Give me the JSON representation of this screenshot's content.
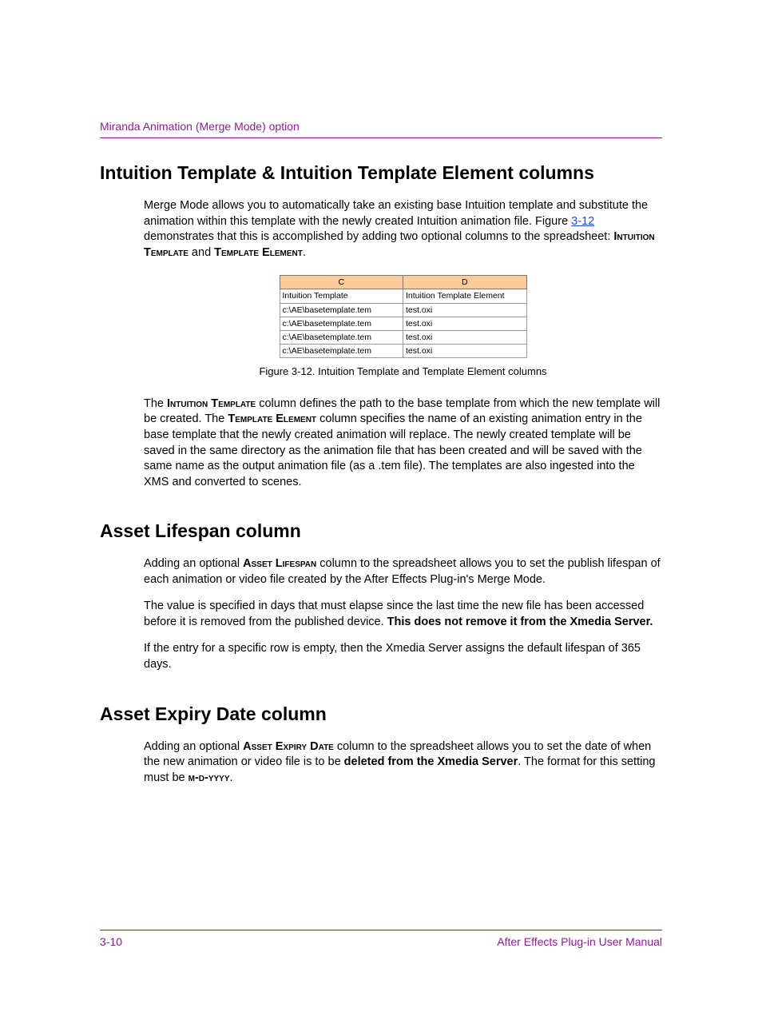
{
  "header": {
    "chapter": "Miranda Animation (Merge Mode) option"
  },
  "section1": {
    "title": "Intuition Template & Intuition Template Element columns",
    "p1a": "Merge Mode allows you to automatically take an existing base Intuition template and substitute the animation within this template with the newly created Intuition animation file. Figure ",
    "p1link": "3-12",
    "p1b": " demonstrates that this is accomplished by adding two optional columns to the spreadsheet: ",
    "p1sc1": "Intuition Template",
    "p1mid": " and ",
    "p1sc2": "Template Element",
    "p1end": ".",
    "caption": "Figure 3-12. Intuition Template and Template Element columns",
    "p2a": "The ",
    "p2sc1": "Intuition Template",
    "p2b": " column defines the path to the base template from which the new template will be created. The ",
    "p2sc2": "Template Element",
    "p2c": " column specifies the name of an existing animation entry in the base template that the newly created animation will replace. The newly created template will be saved in the same directory as the animation file that has been created and will be saved with the same name as the output animation file (as a .tem file). The templates are also ingested into the XMS and converted to scenes."
  },
  "figure": {
    "colC": "C",
    "colD": "D",
    "hdr1": "Intuition Template",
    "hdr2": "Intuition Template Element",
    "rows": [
      {
        "c": "c:\\AE\\basetemplate.tem",
        "d": "test.oxi"
      },
      {
        "c": "c:\\AE\\basetemplate.tem",
        "d": "test.oxi"
      },
      {
        "c": "c:\\AE\\basetemplate.tem",
        "d": "test.oxi"
      },
      {
        "c": "c:\\AE\\basetemplate.tem",
        "d": "test.oxi"
      }
    ]
  },
  "section2": {
    "title": "Asset Lifespan column",
    "p1a": "Adding an optional ",
    "p1sc": "Asset Lifespan",
    "p1b": " column to the spreadsheet allows you to set the publish lifespan of each animation or video file created by the After Effects Plug-in's Merge Mode.",
    "p2a": "The value is specified in days that must elapse since the last time the new file has been accessed before it is removed from the published device. ",
    "p2bold": "This does not remove it from the Xmedia Server.",
    "p3": "If the entry for a specific row is empty, then the Xmedia Server assigns the default lifespan of 365 days."
  },
  "section3": {
    "title": "Asset Expiry Date column",
    "p1a": "Adding an optional ",
    "p1sc": "Asset Expiry Date",
    "p1b": " column to the spreadsheet allows you to set the date of when the new animation or video file is to be ",
    "p1bold": "deleted from the Xmedia Server",
    "p1c": ". The format for this setting must be ",
    "p1sc2": "m-d-yyyy",
    "p1end": "."
  },
  "footer": {
    "page": "3-10",
    "manual": "After Effects Plug-in User Manual"
  }
}
